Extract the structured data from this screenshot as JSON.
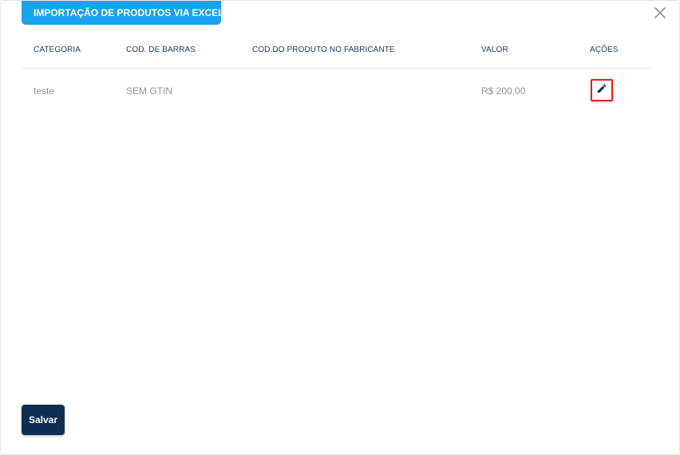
{
  "modal": {
    "title": "IMPORTAÇÃO DE PRODUTOS VIA EXCEL",
    "close_icon": "close-icon"
  },
  "table": {
    "headers": [
      "CATEGORIA",
      "COD. DE BARRAS",
      "COD.DO PRODUTO NO FABRICANTE",
      "VALOR",
      "AÇÕES"
    ],
    "rows": [
      {
        "categoria": "teste",
        "cod_barras": "SEM GTIN",
        "cod_fabricante": "",
        "valor": "R$ 200,00",
        "action_icon": "pencil-edit-icon"
      }
    ]
  },
  "footer": {
    "save_label": "Salvar"
  },
  "colors": {
    "title_bg": "#1aa3ec",
    "header_text": "#1f3a5a",
    "cell_text": "#8e959c",
    "save_bg": "#0f2d52",
    "edit_highlight": "#e02020"
  }
}
